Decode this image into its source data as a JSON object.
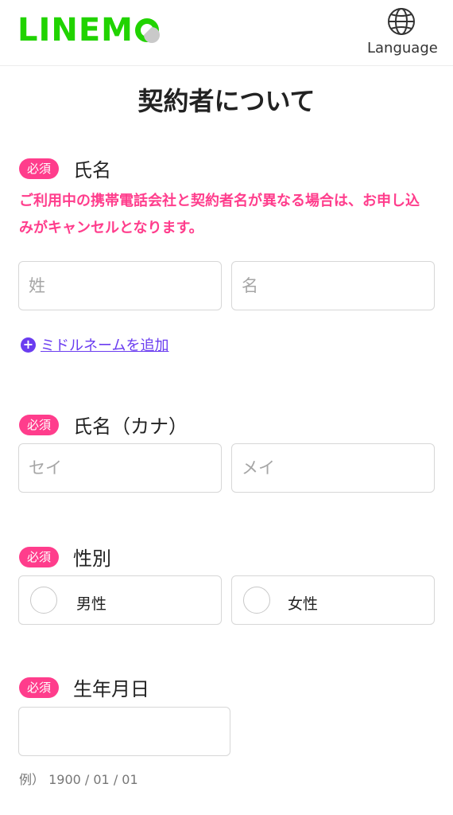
{
  "header": {
    "logo_text": "LINEM",
    "logo_brand": "LINEMO",
    "language_label": "Language"
  },
  "page_title": "契約者について",
  "name_section": {
    "badge": "必須",
    "label": "氏名",
    "warning": "ご利用中の携帯電話会社と契約者名が異なる場合は、お申し込みがキャンセルとなります。",
    "last_name_placeholder": "姓",
    "first_name_placeholder": "名",
    "add_middle_name": "ミドルネームを追加"
  },
  "kana_section": {
    "badge": "必須",
    "label": "氏名（カナ）",
    "last_kana_placeholder": "セイ",
    "first_kana_placeholder": "メイ"
  },
  "gender_section": {
    "badge": "必須",
    "label": "性別",
    "options": [
      "男性",
      "女性"
    ]
  },
  "birth_section": {
    "badge": "必須",
    "label": "生年月日",
    "value": "",
    "example": "例） 1900 / 01 / 01"
  },
  "colors": {
    "brand_green": "#21d300",
    "required_pink": "#ff3d8c",
    "link_purple": "#6a3cf0"
  }
}
